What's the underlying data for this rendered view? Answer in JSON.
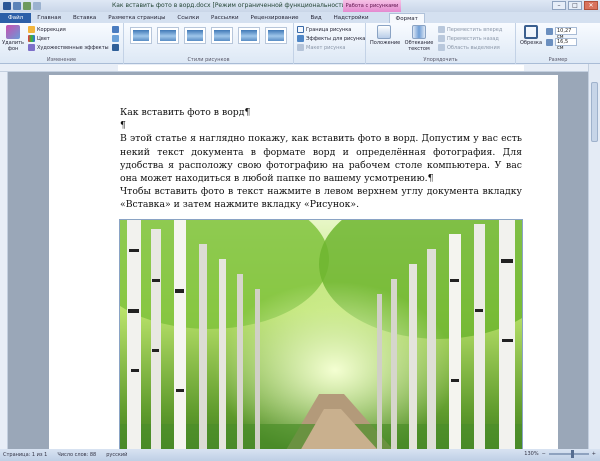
{
  "window": {
    "title": "Как вставить фото в ворд.docx [Режим ограниченной функциональности] - Microsoft Word",
    "context_tab": "Работа с рисунками",
    "minimize": "–",
    "maximize": "□",
    "close": "✕"
  },
  "tabs": [
    {
      "label": "Файл"
    },
    {
      "label": "Главная"
    },
    {
      "label": "Вставка"
    },
    {
      "label": "Разметка страницы"
    },
    {
      "label": "Ссылки"
    },
    {
      "label": "Рассылки"
    },
    {
      "label": "Рецензирование"
    },
    {
      "label": "Вид"
    },
    {
      "label": "Надстройки"
    },
    {
      "label": "Формат"
    }
  ],
  "ribbon": {
    "remove_bg": "Удалить фон",
    "corrections": "Коррекция",
    "color": "Цвет",
    "art_effects": "Художественные эффекты",
    "group_change": "Изменение",
    "group_styles": "Стили рисунков",
    "picture_border": "Граница рисунка",
    "picture_effects": "Эффекты для рисунка",
    "picture_layout": "Макет рисунка",
    "position": "Положение",
    "wrap_text": "Обтекание текстом",
    "bring_forward": "Переместить вперед",
    "send_backward": "Переместить назад",
    "selection_pane": "Область выделения",
    "group_arrange": "Упорядочить",
    "crop": "Обрезка",
    "height": "10,27 см",
    "width": "16,5 см",
    "group_size": "Размер"
  },
  "document": {
    "heading": "Как вставить фото в ворд¶",
    "empty": "¶",
    "p1": "В этой статье я наглядно покажу, как вставить фото в ворд. Допустим у вас есть некий текст документа в формате ворд и определённая фотография. Для удобства я расположу свою фотографию на рабочем столе компьютера. У вас она может находиться в любой папке по вашему усмотрению.¶",
    "p2": "Чтобы вставить фото в текст нажмите в левом верхнем углу документа вкладку «Вставка» и затем нажмите вкладку «Рисунок»."
  },
  "status": {
    "page": "Страница: 1 из 1",
    "words": "Число слов: 88",
    "lang": "русский",
    "zoom": "130%"
  }
}
